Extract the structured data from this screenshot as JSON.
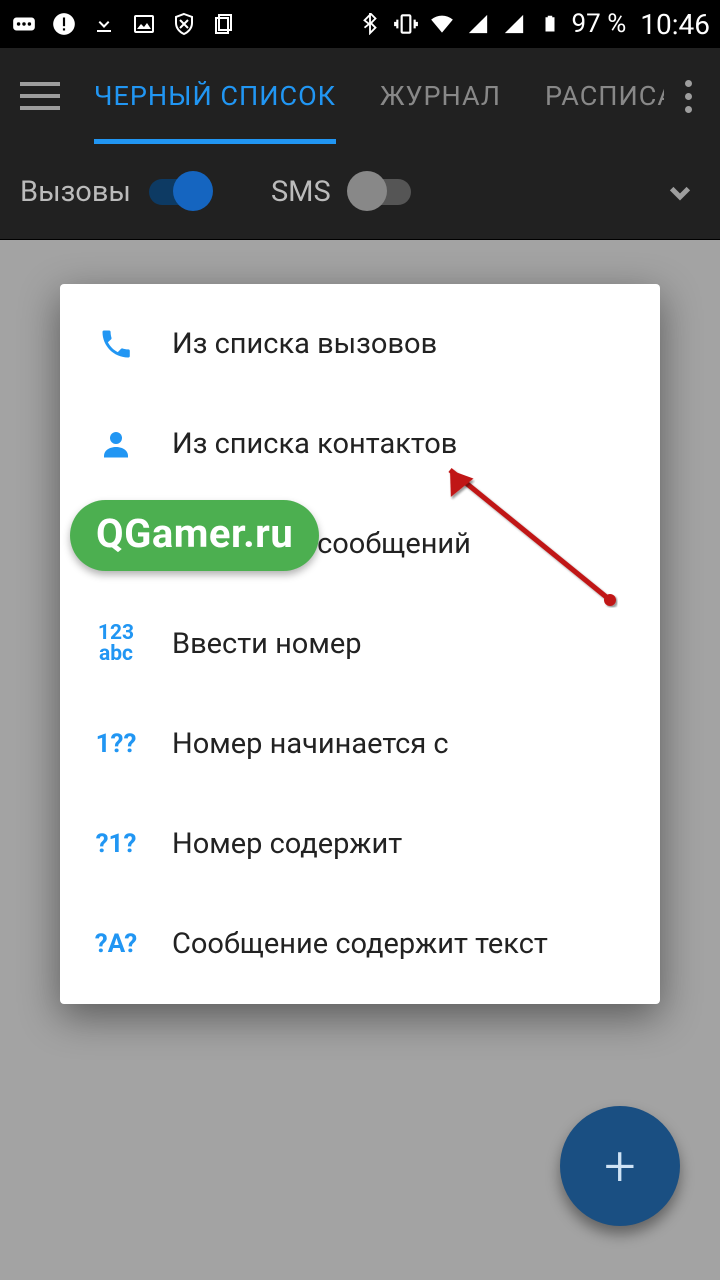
{
  "statusbar": {
    "battery_text": "97 %",
    "time": "10:46"
  },
  "appbar": {
    "tabs": [
      {
        "label": "ЧЕРНЫЙ СПИСОК",
        "active": true
      },
      {
        "label": "ЖУРНАЛ",
        "active": false
      },
      {
        "label": "РАСПИСАНИЕ",
        "active": false
      }
    ]
  },
  "filterbar": {
    "calls_label": "Вызовы",
    "sms_label": "SMS"
  },
  "dialog": {
    "items": [
      {
        "icon": "phone-icon",
        "label": "Из списка вызовов"
      },
      {
        "icon": "person-icon",
        "label": "Из списка контактов"
      },
      {
        "icon": "message-icon",
        "label": "Из списка сообщений"
      },
      {
        "icon": "keypad-icon",
        "label": "Ввести номер"
      },
      {
        "icon": "starts-icon",
        "label": "Номер начинается с"
      },
      {
        "icon": "contains-icon",
        "label": "Номер содержит"
      },
      {
        "icon": "text-icon",
        "label": "Сообщение содержит текст"
      }
    ],
    "icon_text": {
      "keypad_line1": "123",
      "keypad_line2": "abc",
      "starts": "1??",
      "contains": "?1?",
      "textmatch": "?A?"
    }
  },
  "watermark": "QGamer.ru",
  "fab_label": "+"
}
